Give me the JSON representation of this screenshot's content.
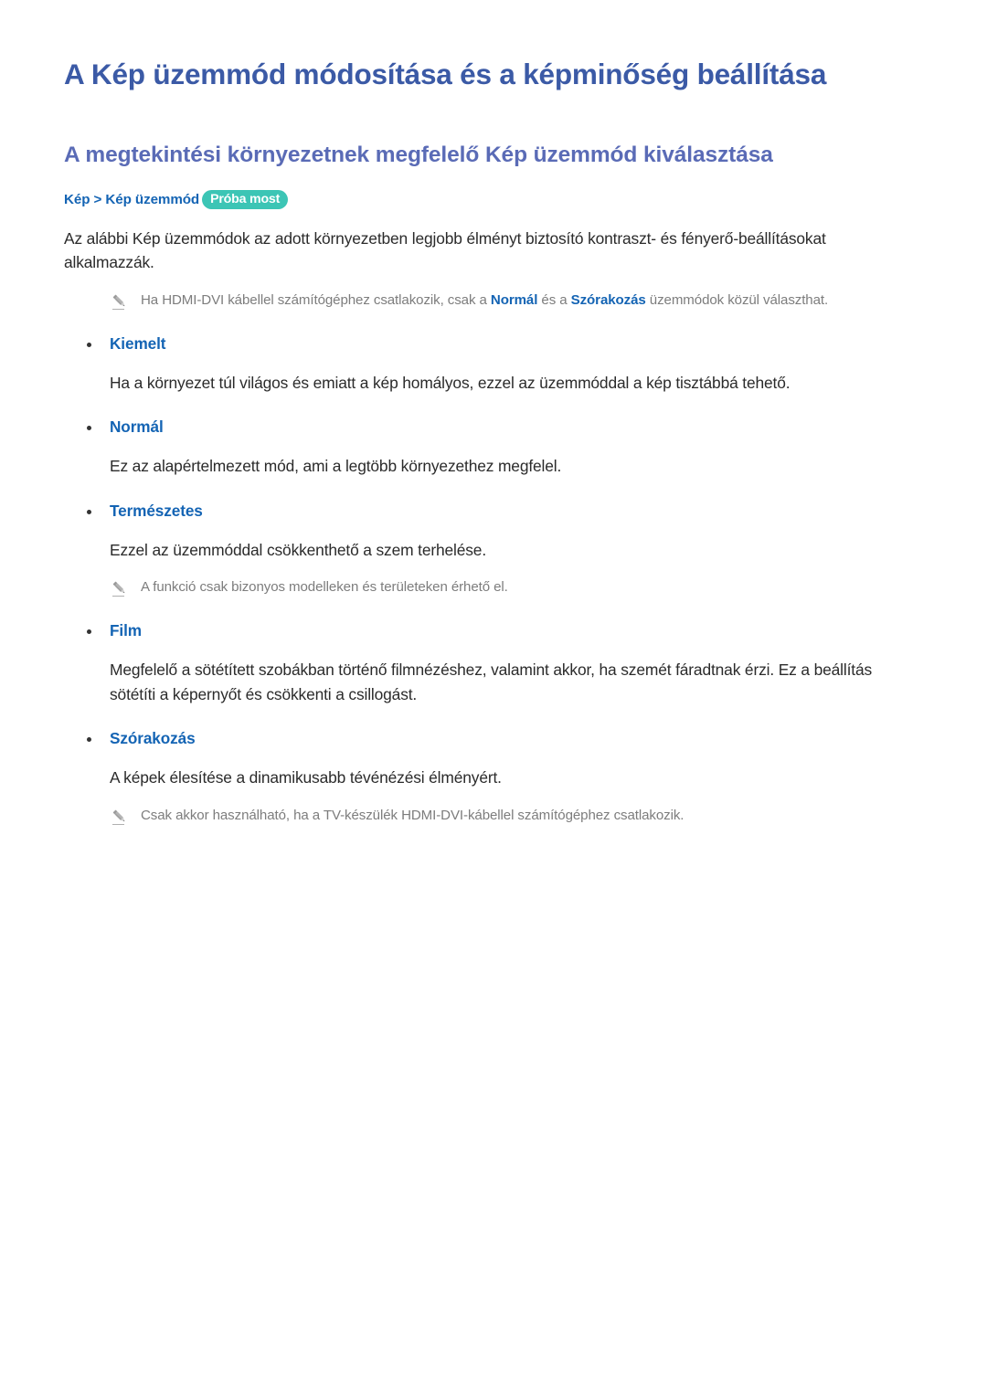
{
  "document": {
    "title": "A Kép üzemmód módosítása és a képminőség beállítása",
    "section_heading": "A megtekintési környezetnek megfelelő Kép üzemmód kiválasztása",
    "breadcrumb": "Kép > Kép üzemmód",
    "try_now_badge": "Próba most",
    "intro_paragraph": "Az alábbi Kép üzemmódok az adott környezetben legjobb élményt biztosító kontraszt- és fényerő-beállításokat alkalmazzák.",
    "intro_note": {
      "prefix": "Ha HDMI-DVI kábellel számítógéphez csatlakozik, csak a ",
      "bold1": "Normál",
      "middle": " és a ",
      "bold2": "Szórakozás",
      "suffix": " üzemmódok közül választhat."
    },
    "modes": [
      {
        "label": "Kiemelt",
        "description": "Ha a környezet túl világos és emiatt a kép homályos, ezzel az üzemmóddal a kép tisztábbá tehető.",
        "note": ""
      },
      {
        "label": "Normál",
        "description": "Ez az alapértelmezett mód, ami a legtöbb környezethez megfelel.",
        "note": ""
      },
      {
        "label": "Természetes",
        "description": "Ezzel az üzemmóddal csökkenthető a szem terhelése.",
        "note": "A funkció csak bizonyos modelleken és területeken érhető el."
      },
      {
        "label": "Film",
        "description": "Megfelelő a sötétített szobákban történő filmnézéshez, valamint akkor, ha szemét fáradtnak érzi. Ez a beállítás sötétíti a képernyőt és csökkenti a csillogást.",
        "note": ""
      },
      {
        "label": "Szórakozás",
        "description": "A képek élesítése a dinamikusabb tévénézési élményért.",
        "note": "Csak akkor használható, ha a TV-készülék HDMI-DVI-kábellel számítógéphez csatlakozik."
      }
    ]
  },
  "colors": {
    "title_blue": "#3b5aa6",
    "heading_blue": "#5a6bb6",
    "breadcrumb_blue": "#1464b4",
    "badge_teal": "#3cc5b5",
    "body_text": "#2b2b2b",
    "note_gray": "#7d7d7d",
    "bullet_dot": "#333333"
  },
  "icons": {
    "note_pencil": "pencil-icon"
  }
}
